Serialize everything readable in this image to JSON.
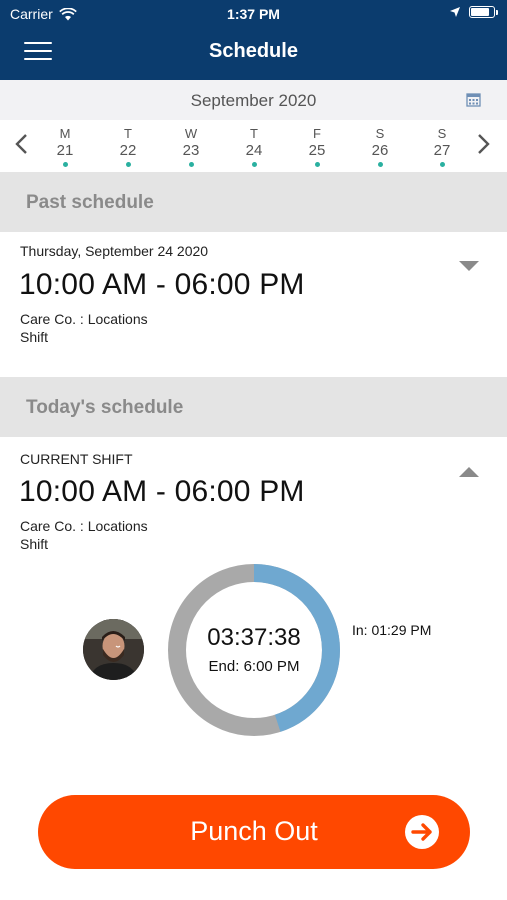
{
  "status_bar": {
    "carrier": "Carrier",
    "time": "1:37 PM",
    "battery_level": 0.85
  },
  "header": {
    "title": "Schedule",
    "menu_icon": "hamburger-menu-icon"
  },
  "month_bar": {
    "title": "September 2020",
    "calendar_icon": "calendar-icon"
  },
  "week": {
    "days": [
      {
        "letter": "M",
        "num": "21",
        "has_dot": true
      },
      {
        "letter": "T",
        "num": "22",
        "has_dot": true
      },
      {
        "letter": "W",
        "num": "23",
        "has_dot": true
      },
      {
        "letter": "T",
        "num": "24",
        "has_dot": true
      },
      {
        "letter": "F",
        "num": "25",
        "has_dot": true
      },
      {
        "letter": "S",
        "num": "26",
        "has_dot": true
      },
      {
        "letter": "S",
        "num": "27",
        "has_dot": true
      }
    ],
    "selected_index": 4
  },
  "past": {
    "section_title": "Past schedule",
    "date": "Thursday, September 24 2020",
    "time_range": "10:00 AM - 06:00 PM",
    "location": "Care Co. : Locations",
    "type": "Shift"
  },
  "today": {
    "section_title": "Today's schedule",
    "label": "CURRENT SHIFT",
    "time_range": "10:00 AM - 06:00 PM",
    "location": "Care Co. : Locations",
    "type": "Shift",
    "timer": "03:37:38",
    "end": "End: 6:00 PM",
    "in_time": "In: 01:29 PM",
    "progress": 0.45
  },
  "punch": {
    "label": "Punch Out",
    "icon": "arrow-right-circle-icon"
  },
  "colors": {
    "header": "#0b3c6e",
    "accent": "#2ab0a0",
    "ring_progress": "#6fa8d0",
    "ring_track": "#a9a9a9",
    "punch": "#ff4800"
  }
}
